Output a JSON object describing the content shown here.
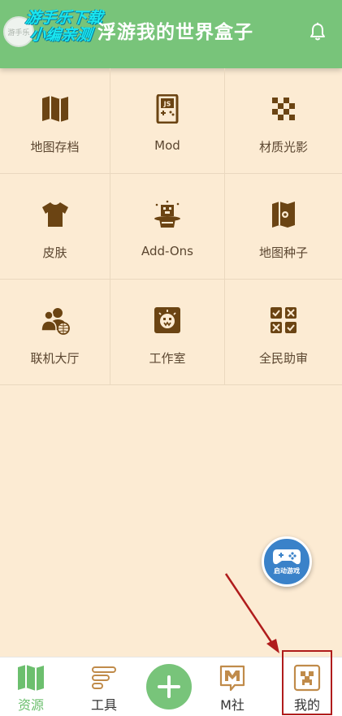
{
  "header": {
    "title": "浮游我的世界盒子",
    "watermark_line1": "游手乐下载",
    "watermark_line2": "小编亲测"
  },
  "grid": [
    {
      "label": "地图存档",
      "icon": "map-icon"
    },
    {
      "label": "Mod",
      "icon": "js-mod-icon"
    },
    {
      "label": "材质光影",
      "icon": "checker-texture-icon"
    },
    {
      "label": "皮肤",
      "icon": "shirt-icon"
    },
    {
      "label": "Add-Ons",
      "icon": "magic-hat-icon"
    },
    {
      "label": "地图种子",
      "icon": "map-seed-icon"
    },
    {
      "label": "联机大厅",
      "icon": "multiplayer-icon"
    },
    {
      "label": "工作室",
      "icon": "studio-icon"
    },
    {
      "label": "全民助审",
      "icon": "review-icon"
    }
  ],
  "fab": {
    "label": "启动游戏"
  },
  "nav": {
    "items": [
      {
        "label": "资源",
        "icon": "map-icon",
        "active": true
      },
      {
        "label": "工具",
        "icon": "tools-icon",
        "active": false
      },
      {
        "label": "",
        "icon": "plus-icon",
        "active": false
      },
      {
        "label": "M社",
        "icon": "m-community-icon",
        "active": false
      },
      {
        "label": "我的",
        "icon": "creeper-face-icon",
        "active": false
      }
    ]
  },
  "colors": {
    "header_green": "#78c47a",
    "background": "#fcebd3",
    "icon_brown": "#6b4413",
    "fab_blue": "#3a82c9",
    "annotation_red": "#b01c1c"
  }
}
